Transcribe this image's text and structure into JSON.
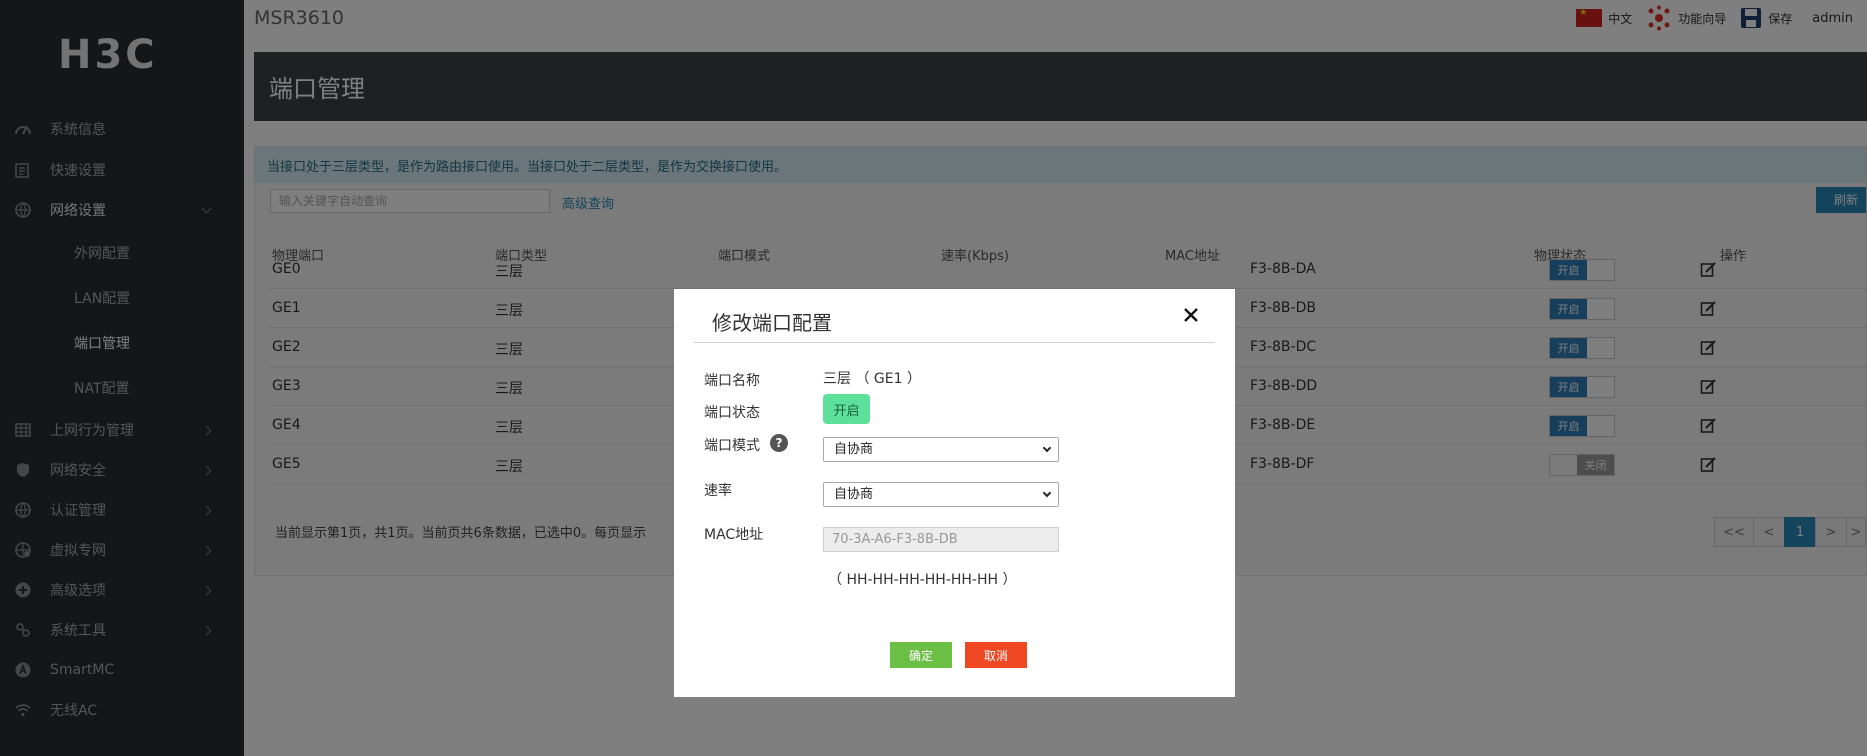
{
  "app": {
    "logo": "H3C",
    "device": "MSR3610"
  },
  "header": {
    "lang": "中文",
    "wizard": "功能向导",
    "save": "保存",
    "user": "admin"
  },
  "sidebar": {
    "items": [
      {
        "label": "系统信息",
        "icon": "speedometer-icon"
      },
      {
        "label": "快速设置",
        "icon": "quick-setup-icon"
      },
      {
        "label": "网络设置",
        "icon": "globe-icon"
      },
      {
        "label": "上网行为管理",
        "icon": "grid-icon"
      },
      {
        "label": "网络安全",
        "icon": "shield-icon"
      },
      {
        "label": "认证管理",
        "icon": "globe-icon"
      },
      {
        "label": "虚拟专网",
        "icon": "vpn-globe-icon"
      },
      {
        "label": "高级选项",
        "icon": "advanced-icon"
      },
      {
        "label": "系统工具",
        "icon": "tools-icon"
      },
      {
        "label": "SmartMC",
        "icon": "smartmc-icon"
      },
      {
        "label": "无线AC",
        "icon": "wifi-icon"
      }
    ],
    "sub": [
      "外网配置",
      "LAN配置",
      "端口管理",
      "NAT配置"
    ]
  },
  "page": {
    "title": "端口管理",
    "info": "当接口处于三层类型，是作为路由接口使用。当接口处于二层类型，是作为交换接口使用。",
    "search_placeholder": "输入关键字自动查询",
    "advanced": "高级查询",
    "refresh": "刷新",
    "columns": [
      "物理端口",
      "端口类型",
      "端口模式",
      "速率(Kbps)",
      "MAC地址",
      "物理状态",
      "操作"
    ],
    "rows": [
      {
        "port": "GE0",
        "type": "三层",
        "mac": "F3-8B-DA",
        "state": "开启"
      },
      {
        "port": "GE1",
        "type": "三层",
        "mac": "F3-8B-DB",
        "state": "开启"
      },
      {
        "port": "GE2",
        "type": "三层",
        "mac": "F3-8B-DC",
        "state": "开启"
      },
      {
        "port": "GE3",
        "type": "三层",
        "mac": "F3-8B-DD",
        "state": "开启"
      },
      {
        "port": "GE4",
        "type": "三层",
        "mac": "F3-8B-DE",
        "state": "开启"
      },
      {
        "port": "GE5",
        "type": "三层",
        "mac": "F3-8B-DF",
        "state": "关闭"
      }
    ],
    "pager_text": "当前显示第1页，共1页。当前页共6条数据，已选中0。每页显示",
    "pager": [
      "<<",
      "<",
      "1",
      ">",
      ">"
    ]
  },
  "modal": {
    "title": "修改端口配置",
    "name_label": "端口名称",
    "name_value": "三层 （ GE1 ）",
    "state_label": "端口状态",
    "state_value": "开启",
    "mode_label": "端口模式",
    "mode_value": "自协商",
    "speed_label": "速率",
    "speed_value": "自协商",
    "mac_label": "MAC地址",
    "mac_value": "70-3A-A6-F3-8B-DB",
    "mac_hint": "（ HH-HH-HH-HH-HH-HH ）",
    "ok": "确定",
    "cancel": "取消"
  },
  "colors": {
    "sidebar": "#2b2d31",
    "titlebar": "#3d4048",
    "accent": "#2b8ab8",
    "ok": "#6bbf45",
    "cancel": "#f04822",
    "on": "#5ce09a"
  }
}
